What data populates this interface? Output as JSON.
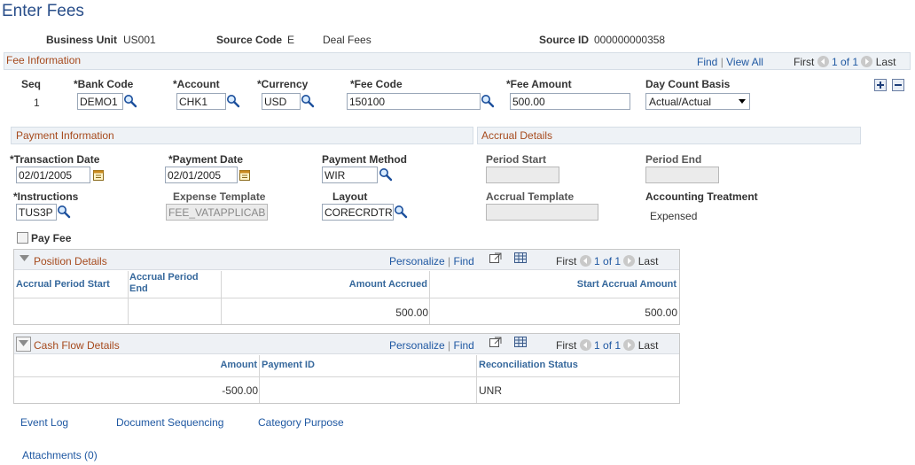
{
  "page": {
    "title": "Enter Fees"
  },
  "header": {
    "business_unit_label": "Business Unit",
    "business_unit": "US001",
    "source_code_label": "Source Code",
    "source_code": "E",
    "source_desc": "Deal Fees",
    "source_id_label": "Source ID",
    "source_id": "000000000358"
  },
  "fee_info": {
    "title": "Fee Information",
    "find": "Find",
    "view_all": "View All",
    "first": "First",
    "count": "1 of 1",
    "last": "Last",
    "cols": {
      "seq": "Seq",
      "bank_code": "*Bank Code",
      "account": "*Account",
      "currency": "*Currency",
      "fee_code": "*Fee Code",
      "fee_amount": "*Fee Amount",
      "day_count": "Day Count Basis"
    },
    "row": {
      "seq": "1",
      "bank_code": "DEMO1",
      "account": "CHK1",
      "currency": "USD",
      "fee_code": "150100",
      "fee_amount": "500.00",
      "day_count": "Actual/Actual"
    }
  },
  "payment_info": {
    "title": "Payment Information",
    "transaction_date_label": "*Transaction Date",
    "transaction_date": "02/01/2005",
    "payment_date_label": "*Payment Date",
    "payment_date": "02/01/2005",
    "payment_method_label": "Payment Method",
    "payment_method": "WIR",
    "instructions_label": "*Instructions",
    "instructions": "TUS3P",
    "expense_template_label": "Expense Template",
    "expense_template": "FEE_VATAPPLICAB",
    "layout_label": "Layout",
    "layout": "CORECRDTR",
    "pay_fee_label": "Pay Fee"
  },
  "accrual": {
    "title": "Accrual Details",
    "period_start_label": "Period Start",
    "period_end_label": "Period End",
    "accrual_template_label": "Accrual Template",
    "accounting_treatment_label": "Accounting Treatment",
    "accounting_treatment": "Expensed"
  },
  "position_details": {
    "title": "Position Details",
    "personalize": "Personalize",
    "find": "Find",
    "first": "First",
    "count": "1 of 1",
    "last": "Last",
    "headers": [
      "Accrual Period Start",
      "Accrual Period End",
      "Amount Accrued",
      "Start Accrual Amount"
    ],
    "row": [
      "",
      "",
      "500.00",
      "500.00"
    ]
  },
  "cash_flow": {
    "title": "Cash Flow Details",
    "personalize": "Personalize",
    "find": "Find",
    "first": "First",
    "count": "1 of 1",
    "last": "Last",
    "headers": [
      "Amount",
      "Payment ID",
      "Reconciliation Status"
    ],
    "row": [
      "-500.00",
      "",
      "UNR"
    ]
  },
  "links": {
    "event_log": "Event Log",
    "document_sequencing": "Document Sequencing",
    "category_purpose": "Category Purpose",
    "attachments": "Attachments (0)"
  }
}
